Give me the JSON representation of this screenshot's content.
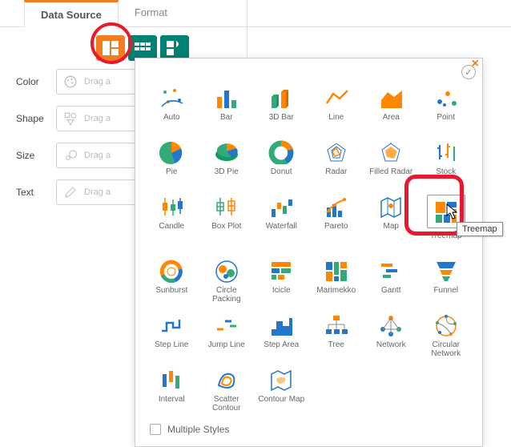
{
  "tabs": {
    "data_source": "Data Source",
    "format": "Format"
  },
  "shelves": {
    "color": {
      "label": "Color",
      "placeholder": "Drag a"
    },
    "shape": {
      "label": "Shape",
      "placeholder": "Drag a"
    },
    "size": {
      "label": "Size",
      "placeholder": "Drag a"
    },
    "text": {
      "label": "Text",
      "placeholder": "Drag a"
    }
  },
  "charts": [
    "Auto",
    "Bar",
    "3D Bar",
    "Line",
    "Area",
    "Point",
    "Pie",
    "3D Pie",
    "Donut",
    "Radar",
    "Filled Radar",
    "Stock",
    "Candle",
    "Box Plot",
    "Waterfall",
    "Pareto",
    "Map",
    "Treemap",
    "Sunburst",
    "Circle Packing",
    "Icicle",
    "Marimekko",
    "Gantt",
    "Funnel",
    "Step Line",
    "Jump Line",
    "Step Area",
    "Tree",
    "Network",
    "Circular Network",
    "Interval",
    "Scatter Contour",
    "Contour Map"
  ],
  "multiple_styles": "Multiple Styles",
  "tooltip": "Treemap"
}
